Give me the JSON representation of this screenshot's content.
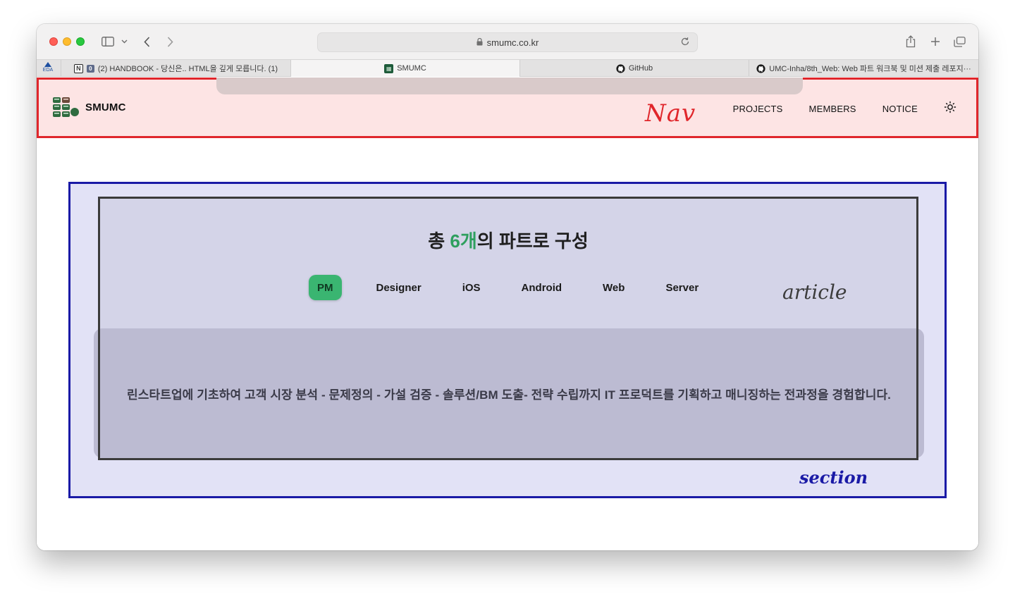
{
  "browser": {
    "url": "smumc.co.kr",
    "pinned_tab_label": "EDA",
    "tabs": [
      {
        "label": "(2) HANDBOOK - 당신은.. HTML을 깊게 모릅니다. (1)",
        "favicon": "notion-icon",
        "active": false
      },
      {
        "label": "SMUMC",
        "favicon": "smumc-favicon",
        "active": true
      },
      {
        "label": "GitHub",
        "favicon": "github-icon",
        "active": false
      },
      {
        "label": "UMC-Inha/8th_Web: Web 파트 워크북 및 미션 제출 레포지···",
        "favicon": "github-icon",
        "active": false
      }
    ]
  },
  "nav": {
    "logo_text": "SMUMC",
    "links": [
      "PROJECTS",
      "MEMBERS",
      "NOTICE"
    ],
    "theme_toggle_icon": "sun-icon",
    "annotation": "Nav"
  },
  "section": {
    "annotation": "section",
    "article": {
      "annotation": "article",
      "headline_prefix": "총 ",
      "headline_accent": "6개",
      "headline_suffix": "의 파트로 구성",
      "tabs": [
        "PM",
        "Designer",
        "iOS",
        "Android",
        "Web",
        "Server"
      ],
      "active_tab": "PM",
      "description": "린스타트업에 기초하여 고객 시장 분석 - 문제정의 - 가설 검증 - 솔루션/BM 도출- 전략 수립까지 IT 프로덕트를 기획하고 매니징하는 전과정을 경험합니다."
    }
  },
  "colors": {
    "nav_annotation": "#e0262b",
    "section_annotation": "#1a1aa6",
    "accent_green": "#3ab571"
  }
}
